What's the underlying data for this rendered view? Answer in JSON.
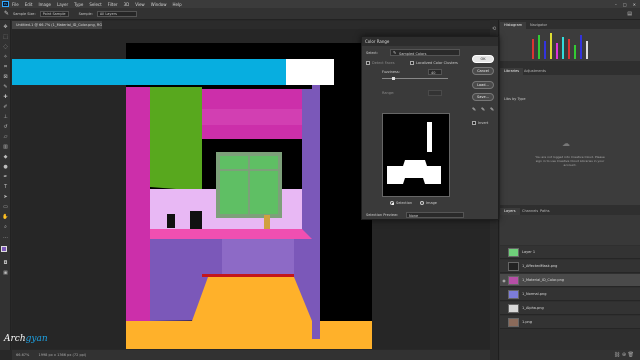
{
  "menubar": {
    "items": [
      "File",
      "Edit",
      "Image",
      "Layer",
      "Type",
      "Select",
      "Filter",
      "3D",
      "View",
      "Window",
      "Help"
    ]
  },
  "optionsbar": {
    "sample_size_label": "Sample Size:",
    "sample_size_value": "Point Sample",
    "sample_label": "Sample:",
    "sample_value": "All Layers"
  },
  "document": {
    "tab_title": "Untitled-1 @ 66.7% (1_Material_ID_Color.png, RGB/8)"
  },
  "status": {
    "zoom": "66.67%",
    "doc_info": "1998 px x 1366 px (72 ppi)"
  },
  "right_panel": {
    "top_tabs": [
      "Histogram",
      "Navigator"
    ],
    "mid_tabs": [
      "Libraries",
      "Adjustments"
    ],
    "library_select": "Libs by Type",
    "library_message": "You are not logged into Creative Cloud. Please sign in to use Creative Cloud Libraries in your account.",
    "layer_tabs": [
      "Layers",
      "Channels",
      "Paths"
    ],
    "layers": [
      {
        "name": "Layer 1",
        "thumb": "#6fcf7a"
      },
      {
        "name": "1_AffectedMask.png",
        "thumb": "#222222"
      },
      {
        "name": "1_Material_ID_Color.png",
        "thumb": "#b64fa6"
      },
      {
        "name": "1_Normal.png",
        "thumb": "#7d7dd9"
      },
      {
        "name": "1_Alpha.png",
        "thumb": "#d8d8d8"
      },
      {
        "name": "1.png",
        "thumb": "#8a6a5a"
      }
    ]
  },
  "color_range": {
    "title": "Color Range",
    "select_label": "Select:",
    "select_value": "Sampled Colors",
    "detect_faces": "Detect Faces",
    "localized": "Localized Color Clusters",
    "fuzziness_label": "Fuzziness:",
    "fuzziness_value": "40",
    "range_label": "Range:",
    "range_value": "",
    "selection_label": "Selection",
    "image_label": "Image",
    "preview_label": "Selection Preview:",
    "preview_value": "None",
    "ok": "OK",
    "cancel": "Cancel",
    "load": "Load...",
    "save": "Save...",
    "invert": "Invert"
  },
  "brand": {
    "logo_text_a": "Arch",
    "logo_text_b": "gyan"
  },
  "colors": {
    "magenta": "#cc2faa",
    "green": "#58a81e",
    "cyan": "#07aee0",
    "yellow": "#ffb12a",
    "purple": "#7b58b9",
    "pink": "#f04fb1",
    "lilac": "#e8b8f4",
    "window_green": "#5fbf64"
  }
}
